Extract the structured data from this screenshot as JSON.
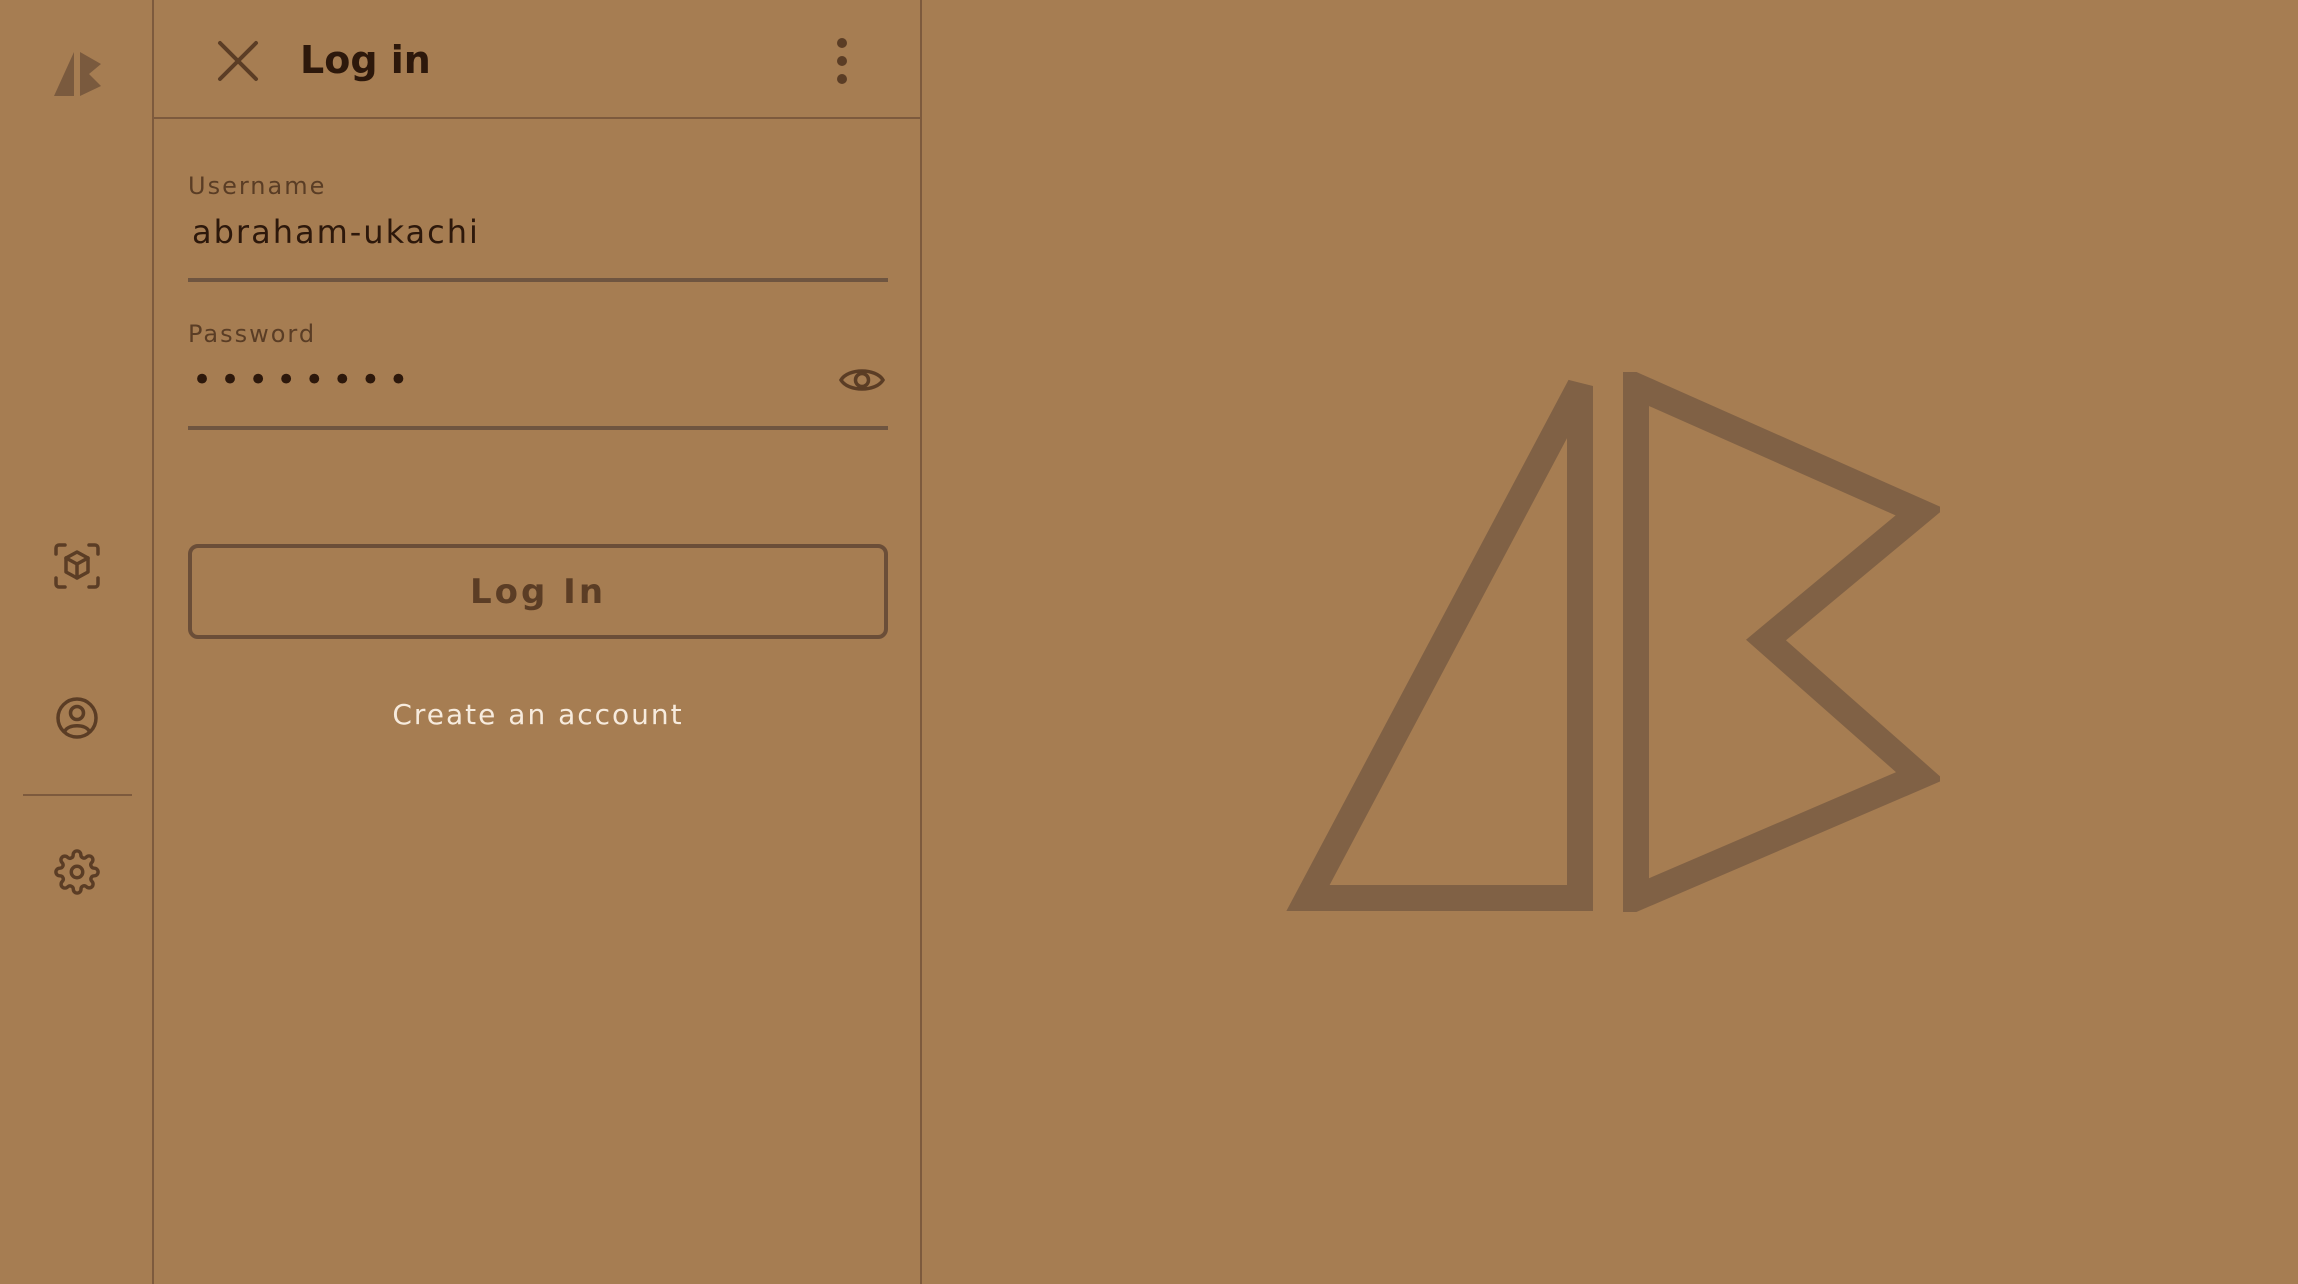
{
  "rail": {
    "logo_icon": "brand-logo-icon",
    "items": [
      {
        "name": "scan",
        "icon": "cube-scan-icon"
      },
      {
        "name": "profile",
        "icon": "user-circle-icon"
      },
      {
        "name": "settings",
        "icon": "gear-icon"
      }
    ]
  },
  "panel": {
    "title": "Log in",
    "close_icon": "close-icon",
    "more_icon": "more-vertical-icon"
  },
  "form": {
    "username": {
      "label": "Username",
      "value": "abraham-ukachi"
    },
    "password": {
      "label": "Password",
      "value": "••••••••",
      "toggle_icon": "eye-icon"
    },
    "submit_label": "Log In",
    "create_account_label": "Create an account"
  },
  "colors": {
    "background": "#a67d52",
    "outline": "#7d5a3d",
    "text_dark": "#2d180b",
    "link": "#f7ebdd"
  }
}
